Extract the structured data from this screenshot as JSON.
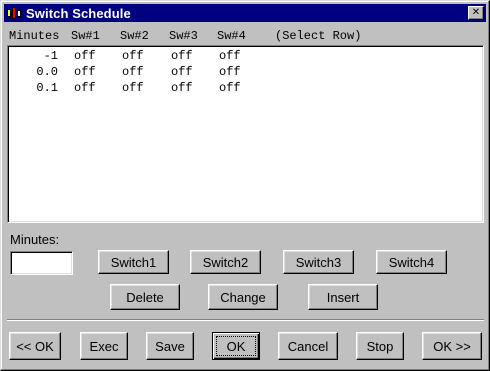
{
  "window": {
    "title": "Switch Schedule",
    "close_glyph": "✕",
    "colors": {
      "titlebar": "#000080",
      "face": "#c0c0c0"
    }
  },
  "table": {
    "headers": {
      "minutes": "Minutes",
      "sw1": "Sw#1",
      "sw2": "Sw#2",
      "sw3": "Sw#3",
      "sw4": "Sw#4",
      "hint": "(Select Row)"
    },
    "rows": [
      {
        "minutes": "-1",
        "sw1": "off",
        "sw2": "off",
        "sw3": "off",
        "sw4": "off"
      },
      {
        "minutes": "0.0",
        "sw1": "off",
        "sw2": "off",
        "sw3": "off",
        "sw4": "off"
      },
      {
        "minutes": "0.1",
        "sw1": "off",
        "sw2": "off",
        "sw3": "off",
        "sw4": "off"
      }
    ]
  },
  "minutes_field": {
    "label": "Minutes:",
    "value": ""
  },
  "switch_buttons": {
    "sw1": "Switch1",
    "sw2": "Switch2",
    "sw3": "Switch3",
    "sw4": "Switch4"
  },
  "edit_buttons": {
    "delete": "Delete",
    "change": "Change",
    "insert": "Insert"
  },
  "bottom_buttons": {
    "prev_ok": "<< OK",
    "exec": "Exec",
    "save": "Save",
    "ok": "OK",
    "cancel": "Cancel",
    "stop": "Stop",
    "next_ok": "OK >>"
  }
}
